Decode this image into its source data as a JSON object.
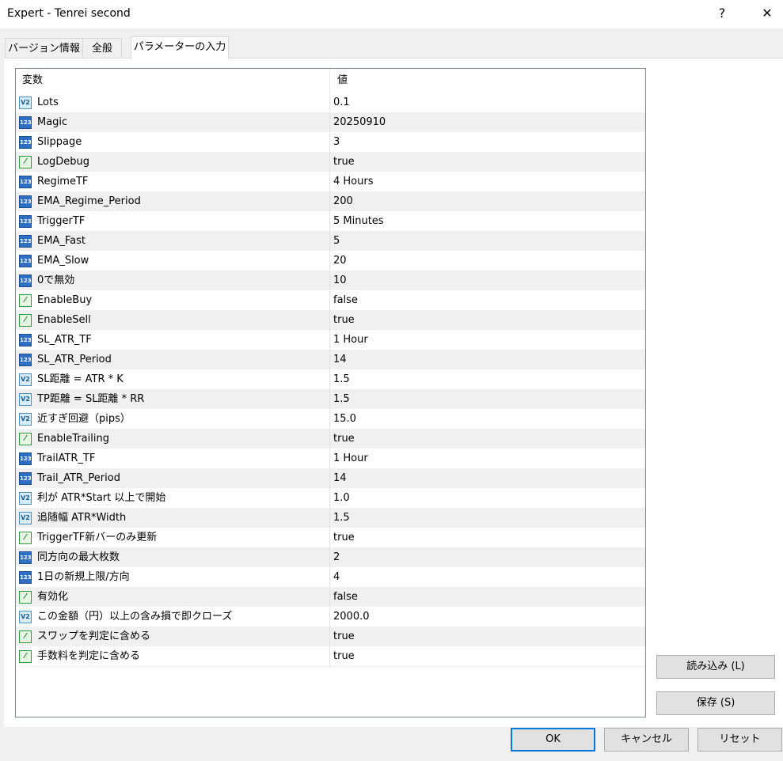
{
  "window": {
    "title": "Expert - Tenrei second",
    "help_glyph": "?",
    "close_glyph": "✕"
  },
  "tabs": [
    {
      "label": "バージョン情報"
    },
    {
      "label": "全般"
    },
    {
      "label": "パラメーターの入力"
    }
  ],
  "grid": {
    "col_name": "変数",
    "col_value": "値",
    "rows": [
      {
        "name": "Lots",
        "value": "0.1",
        "type": "double"
      },
      {
        "name": "Magic",
        "value": "20250910",
        "type": "int"
      },
      {
        "name": "Slippage",
        "value": "3",
        "type": "int"
      },
      {
        "name": "LogDebug",
        "value": "true",
        "type": "bool"
      },
      {
        "name": "RegimeTF",
        "value": "4 Hours",
        "type": "int"
      },
      {
        "name": "EMA_Regime_Period",
        "value": "200",
        "type": "int"
      },
      {
        "name": "TriggerTF",
        "value": "5 Minutes",
        "type": "int"
      },
      {
        "name": "EMA_Fast",
        "value": "5",
        "type": "int"
      },
      {
        "name": "EMA_Slow",
        "value": "20",
        "type": "int"
      },
      {
        "name": "0で無効",
        "value": "10",
        "type": "int"
      },
      {
        "name": "EnableBuy",
        "value": "false",
        "type": "bool"
      },
      {
        "name": "EnableSell",
        "value": "true",
        "type": "bool"
      },
      {
        "name": "SL_ATR_TF",
        "value": "1 Hour",
        "type": "int"
      },
      {
        "name": "SL_ATR_Period",
        "value": "14",
        "type": "int"
      },
      {
        "name": "SL距離 = ATR * K",
        "value": "1.5",
        "type": "double"
      },
      {
        "name": "TP距離 = SL距離 * RR",
        "value": "1.5",
        "type": "double"
      },
      {
        "name": "近すぎ回避（pips）",
        "value": "15.0",
        "type": "double"
      },
      {
        "name": "EnableTrailing",
        "value": "true",
        "type": "bool"
      },
      {
        "name": "TrailATR_TF",
        "value": "1 Hour",
        "type": "int"
      },
      {
        "name": "Trail_ATR_Period",
        "value": "14",
        "type": "int"
      },
      {
        "name": "利が ATR*Start 以上で開始",
        "value": "1.0",
        "type": "double"
      },
      {
        "name": "追随幅 ATR*Width",
        "value": "1.5",
        "type": "double"
      },
      {
        "name": "TriggerTF新バーのみ更新",
        "value": "true",
        "type": "bool"
      },
      {
        "name": "同方向の最大枚数",
        "value": "2",
        "type": "int"
      },
      {
        "name": "1日の新規上限/方向",
        "value": "4",
        "type": "int"
      },
      {
        "name": "有効化",
        "value": "false",
        "type": "bool"
      },
      {
        "name": "この金額（円）以上の含み損で即クローズ",
        "value": "2000.0",
        "type": "double"
      },
      {
        "name": "スワップを判定に含める",
        "value": "true",
        "type": "bool"
      },
      {
        "name": "手数料を判定に含める",
        "value": "true",
        "type": "bool"
      }
    ]
  },
  "icons": {
    "int": "123",
    "double": "V2",
    "bool": "⁄"
  },
  "buttons": {
    "load": "読み込み (L)",
    "save": "保存 (S)",
    "ok": "OK",
    "cancel": "キャンセル",
    "reset": "リセット"
  }
}
